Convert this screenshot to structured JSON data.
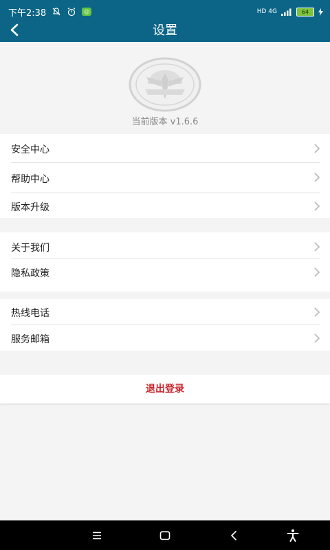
{
  "status_bar": {
    "time": "下午2:38",
    "app_badge": "☺",
    "network": "HD 4G",
    "battery": "64"
  },
  "header": {
    "title": "设置"
  },
  "about": {
    "version_text": "当前版本  v1.6.6"
  },
  "groups": [
    {
      "items": [
        {
          "label": "安全中心"
        },
        {
          "label": "帮助中心"
        },
        {
          "label": "版本升级"
        }
      ]
    },
    {
      "items": [
        {
          "label": "关于我们"
        },
        {
          "label": "隐私政策"
        }
      ]
    },
    {
      "items": [
        {
          "label": "热线电话"
        },
        {
          "label": "服务邮箱"
        }
      ]
    }
  ],
  "logout": {
    "label": "退出登录"
  },
  "colors": {
    "header_bg": "#0c6586",
    "logout_text": "#c8262c",
    "page_bg": "#f4f4f4"
  },
  "icons": {
    "back": "chevron-left-icon",
    "row_arrow": "chevron-right-icon",
    "nav_menu": "menu-icon",
    "nav_home": "home-square-icon",
    "nav_back": "back-icon",
    "nav_accessibility": "accessibility-icon"
  }
}
